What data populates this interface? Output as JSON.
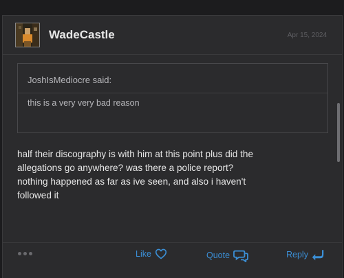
{
  "post": {
    "author": "WadeCastle",
    "date": "Apr 15, 2024",
    "quote": {
      "author_line": "JoshIsMediocre said:",
      "text": "this is a very very bad reason"
    },
    "body_lines": [
      "half their discography is with him at this point plus did the",
      "allegations go anywhere? was there a police report?",
      "nothing happened as far as ive seen, and also i haven't",
      "followed it"
    ],
    "actions": {
      "like": "Like",
      "quote": "Quote",
      "reply": "Reply"
    }
  },
  "colors": {
    "accent": "#3b8fd6",
    "background": "#2b2b2d",
    "text": "#e6e6e6"
  },
  "icons": {
    "like": "heart-outline-icon",
    "quote": "speech-bubble-icon",
    "reply": "reply-arrow-icon",
    "more": "more-dots-icon"
  }
}
